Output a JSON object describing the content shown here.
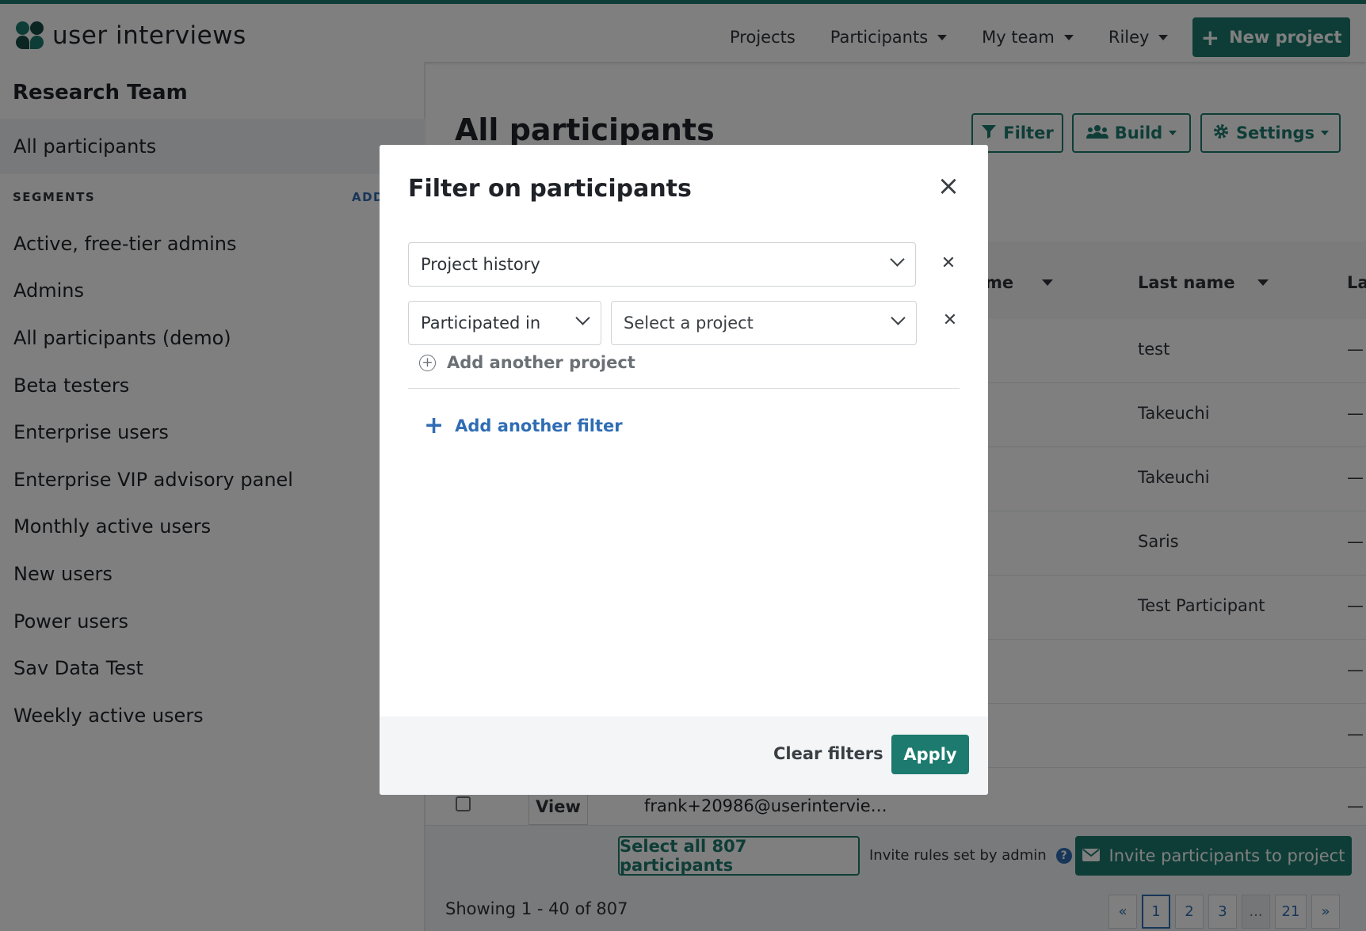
{
  "brand": {
    "name": "user interviews"
  },
  "nav": {
    "projects": "Projects",
    "participants": "Participants",
    "my_team": "My team",
    "user": "Riley",
    "new_project": "New project"
  },
  "sidebar": {
    "team_title": "Research Team",
    "all_participants": "All participants",
    "segments_heading": "SEGMENTS",
    "segments_add": "ADD",
    "segments": [
      "Active, free-tier admins",
      "Admins",
      "All participants (demo)",
      "Beta testers",
      "Enterprise users",
      "Enterprise VIP advisory panel",
      "Monthly active users",
      "New users",
      "Power users",
      "Sav Data Test",
      "Weekly active users"
    ]
  },
  "main": {
    "title": "All participants",
    "filter_btn": "Filter",
    "build_btn": "Build",
    "settings_btn": "Settings",
    "columns": {
      "first_name_partial": "me",
      "last_name": "Last name",
      "next_partial": "La"
    },
    "rows": [
      {
        "last_name": "test",
        "dash": "—"
      },
      {
        "last_name": "Takeuchi",
        "dash": "—"
      },
      {
        "last_name": "Takeuchi",
        "dash": "—"
      },
      {
        "last_name": "Saris",
        "dash": "—"
      },
      {
        "last_name": "Test Participant",
        "dash": "—"
      },
      {
        "last_name": "",
        "dash": "—"
      },
      {
        "last_name": "",
        "dash": "—"
      }
    ],
    "last_row": {
      "view": "View",
      "email": "frank+20986@userintervie…",
      "dash": "—"
    },
    "select_all": "Select all 807 participants",
    "invite_rules": "Invite rules set by admin",
    "invite_btn": "Invite participants to project",
    "showing": "Showing 1 - 40 of 807",
    "pager": {
      "first": "«",
      "pages": [
        "1",
        "2",
        "3"
      ],
      "ellipsis": "...",
      "last_page": "21",
      "next": "»",
      "current": "1"
    }
  },
  "modal": {
    "title": "Filter on participants",
    "filter_type": "Project history",
    "condition": "Participated in",
    "project_placeholder": "Select a project",
    "add_project": "Add another project",
    "add_filter": "Add another filter",
    "clear": "Clear filters",
    "apply": "Apply"
  },
  "colors": {
    "brand_green": "#1d7a6e",
    "link_blue": "#2f6db3"
  }
}
